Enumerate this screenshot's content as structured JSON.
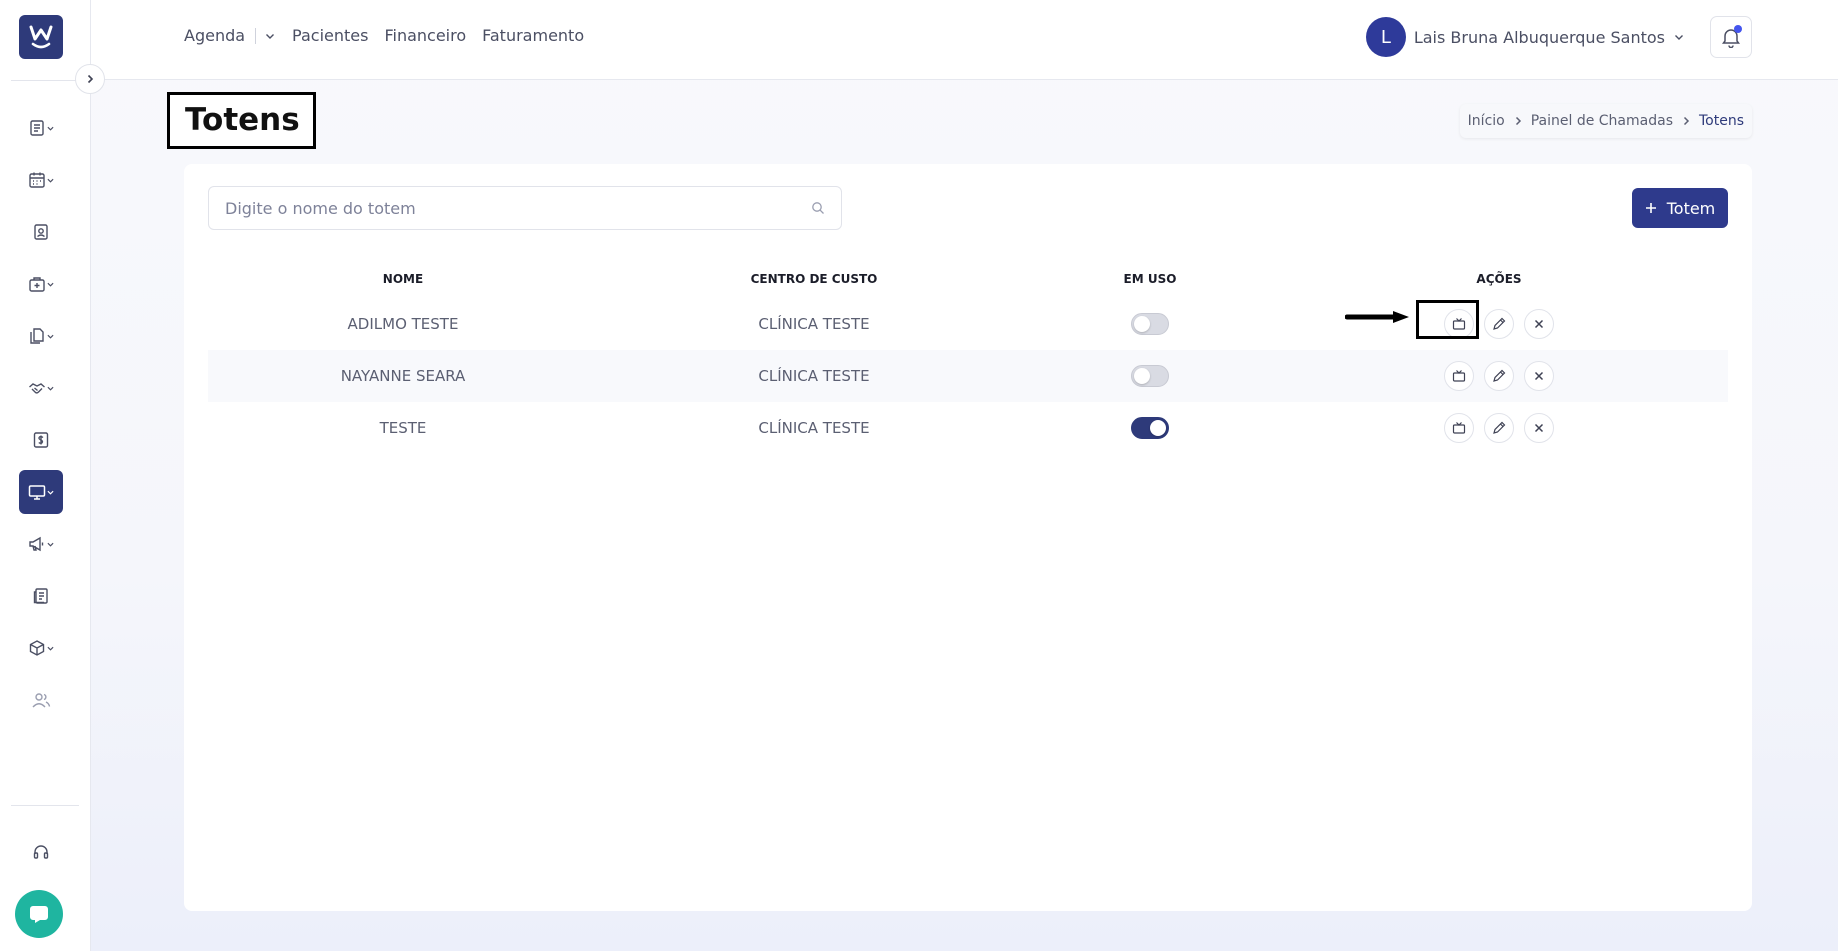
{
  "sidebar": {
    "logo_icon": "wiki-logo-icon",
    "items": [
      {
        "icon": "list-doc-icon",
        "has_chevron": true
      },
      {
        "icon": "calendar-icon",
        "has_chevron": true
      },
      {
        "icon": "patient-card-icon",
        "has_chevron": false
      },
      {
        "icon": "medical-bag-icon",
        "has_chevron": true
      },
      {
        "icon": "documents-icon",
        "has_chevron": true
      },
      {
        "icon": "handshake-icon",
        "has_chevron": true
      },
      {
        "icon": "dollar-icon",
        "has_chevron": false
      },
      {
        "icon": "monitor-icon",
        "has_chevron": true,
        "active": true
      },
      {
        "icon": "megaphone-icon",
        "has_chevron": true
      },
      {
        "icon": "report-icon",
        "has_chevron": false
      },
      {
        "icon": "box-icon",
        "has_chevron": true
      },
      {
        "icon": "users-icon",
        "has_chevron": false
      }
    ],
    "support_icon": "headset-icon",
    "chat_icon": "chat-bubble-icon"
  },
  "topbar": {
    "nav": [
      "Agenda",
      "Pacientes",
      "Financeiro",
      "Faturamento"
    ],
    "user_initial": "L",
    "user_name": "Lais Bruna Albuquerque Santos"
  },
  "header": {
    "title": "Totens",
    "breadcrumb": [
      "Início",
      "Painel de Chamadas",
      "Totens"
    ]
  },
  "search": {
    "placeholder": "Digite o nome do totem",
    "value": ""
  },
  "add_button": {
    "label": "Totem"
  },
  "table": {
    "columns": [
      "NOME",
      "CENTRO DE CUSTO",
      "EM USO",
      "AÇÕES"
    ],
    "rows": [
      {
        "nome": "ADILMO TESTE",
        "centro": "CLÍNICA TESTE",
        "em_uso": false
      },
      {
        "nome": "NAYANNE SEARA",
        "centro": "CLÍNICA TESTE",
        "em_uso": false
      },
      {
        "nome": "TESTE",
        "centro": "CLÍNICA TESTE",
        "em_uso": true
      }
    ]
  },
  "colors": {
    "primary": "#2e3a7a",
    "chat": "#1fb5a0",
    "notification": "#4455ee"
  }
}
